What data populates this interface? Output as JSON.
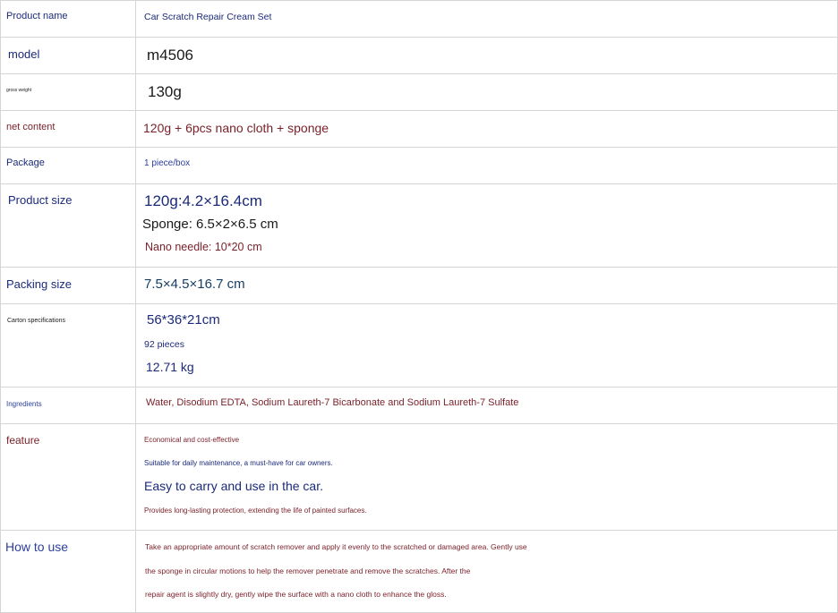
{
  "rows": [
    {
      "label": "Product name",
      "values": [
        "Car Scratch Repair Cream Set"
      ]
    },
    {
      "label": "model",
      "values": [
        "m4506"
      ]
    },
    {
      "label": "gross weight",
      "values": [
        "130g"
      ]
    },
    {
      "label": "net content",
      "values": [
        "120g + 6pcs nano cloth + sponge"
      ]
    },
    {
      "label": "Package",
      "values": [
        "1 piece/box"
      ]
    },
    {
      "label": "Product size",
      "values": [
        "120g:4.2×16.4cm",
        "Sponge: 6.5×2×6.5 cm",
        "Nano needle: 10*20 cm"
      ]
    },
    {
      "label": "Packing size",
      "values": [
        "7.5×4.5×16.7 cm"
      ]
    },
    {
      "label": "Carton specifications",
      "values": [
        "56*36*21cm",
        "92 pieces",
        "12.71 kg"
      ]
    },
    {
      "label": "Ingredients",
      "values": [
        "Water, Disodium EDTA, Sodium Laureth-7 Bicarbonate and Sodium Laureth-7 Sulfate"
      ]
    },
    {
      "label": "feature",
      "values": [
        "Economical and cost-effective",
        "Suitable for daily maintenance, a must-have for car owners.",
        "Easy to carry and use in the car.",
        "Provides long-lasting protection, extending the life of painted surfaces."
      ]
    },
    {
      "label": "How to use",
      "values": [
        "Take an appropriate amount of scratch remover and apply it evenly to the scratched or damaged area. Gently use",
        "the sponge in circular motions to help the remover penetrate and remove the scratches. After the",
        "repair agent is slightly dry, gently wipe the surface with a nano cloth to enhance the gloss."
      ]
    }
  ]
}
